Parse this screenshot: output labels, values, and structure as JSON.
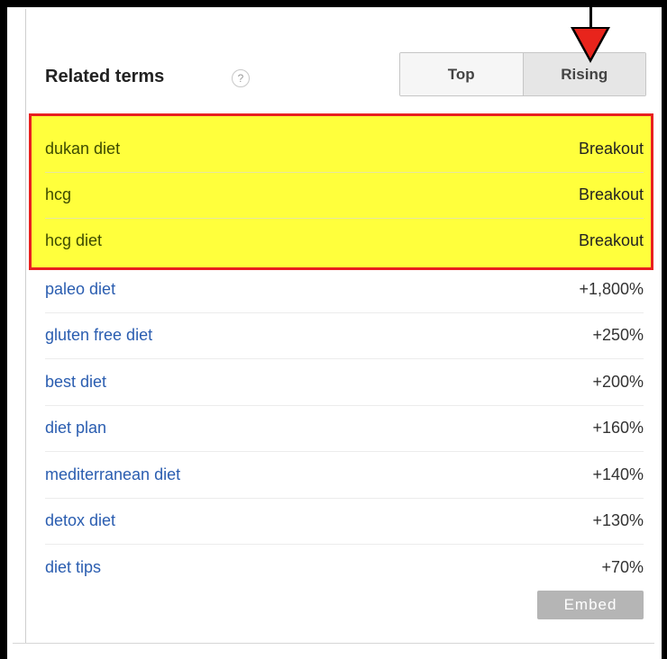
{
  "panel": {
    "title": "Related terms",
    "help_icon": "?"
  },
  "toggle": {
    "top_label": "Top",
    "rising_label": "Rising",
    "selected": "Rising"
  },
  "highlight_color": "#ffff3c",
  "highlight_border_color": "#e82020",
  "link_color": "#2a5db0",
  "rows": [
    {
      "term": "dukan diet",
      "value": "Breakout",
      "highlighted": true
    },
    {
      "term": "hcg",
      "value": "Breakout",
      "highlighted": true
    },
    {
      "term": "hcg diet",
      "value": "Breakout",
      "highlighted": true
    },
    {
      "term": "paleo diet",
      "value": "+1,800%",
      "highlighted": false
    },
    {
      "term": "gluten free diet",
      "value": "+250%",
      "highlighted": false
    },
    {
      "term": "best diet",
      "value": "+200%",
      "highlighted": false
    },
    {
      "term": "diet plan",
      "value": "+160%",
      "highlighted": false
    },
    {
      "term": "mediterranean diet",
      "value": "+140%",
      "highlighted": false
    },
    {
      "term": "detox diet",
      "value": "+130%",
      "highlighted": false
    },
    {
      "term": "diet tips",
      "value": "+70%",
      "highlighted": false
    }
  ],
  "embed_label": "Embed"
}
